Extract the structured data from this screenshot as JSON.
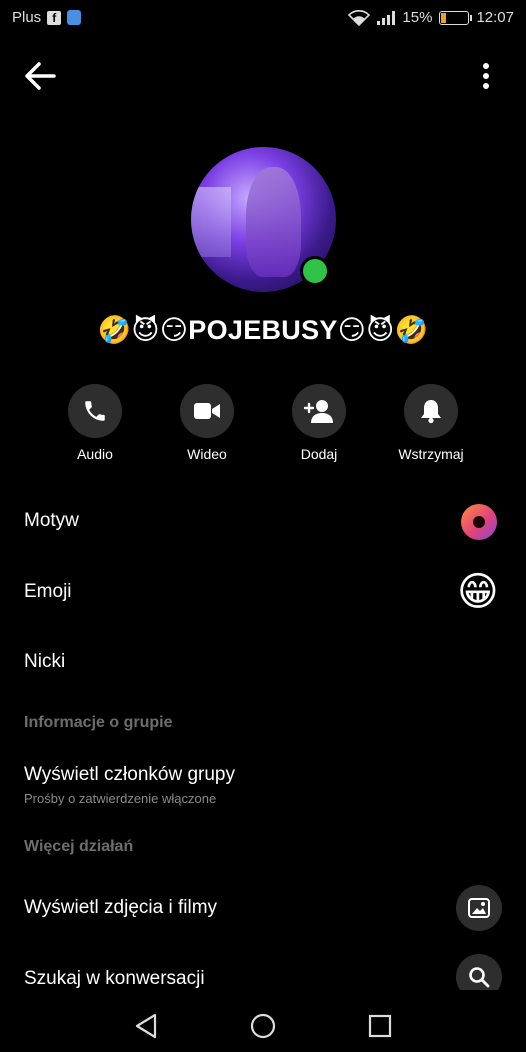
{
  "status_bar": {
    "carrier": "Plus",
    "battery": "15%",
    "time": "12:07"
  },
  "header": {
    "back_icon": "arrow-left-icon",
    "more_icon": "more-vertical-icon"
  },
  "profile": {
    "group_name": "🤣😈😏POJEBUSY😏😈🤣",
    "online": true
  },
  "actions": [
    {
      "label": "Audio",
      "icon": "phone-icon"
    },
    {
      "label": "Wideo",
      "icon": "video-icon"
    },
    {
      "label": "Dodaj",
      "icon": "add-person-icon"
    },
    {
      "label": "Wstrzymaj",
      "icon": "bell-icon"
    }
  ],
  "settings": {
    "motyw": "Motyw",
    "emoji": "Emoji",
    "emoji_value": "😁",
    "nicki": "Nicki"
  },
  "sections": {
    "group_info": "Informacje o grupie",
    "more_actions": "Więcej działań"
  },
  "group_info": {
    "view_members": "Wyświetl członków grupy",
    "view_members_sub": "Prośby o zatwierdzenie włączone"
  },
  "more_actions": {
    "view_media": "Wyświetl zdjęcia i filmy",
    "search": "Szukaj w konwersacji"
  },
  "colors": {
    "background": "#000000",
    "online": "#31c24a",
    "icon_bg": "#2e2e2e",
    "section_text": "#6d6d6d"
  }
}
